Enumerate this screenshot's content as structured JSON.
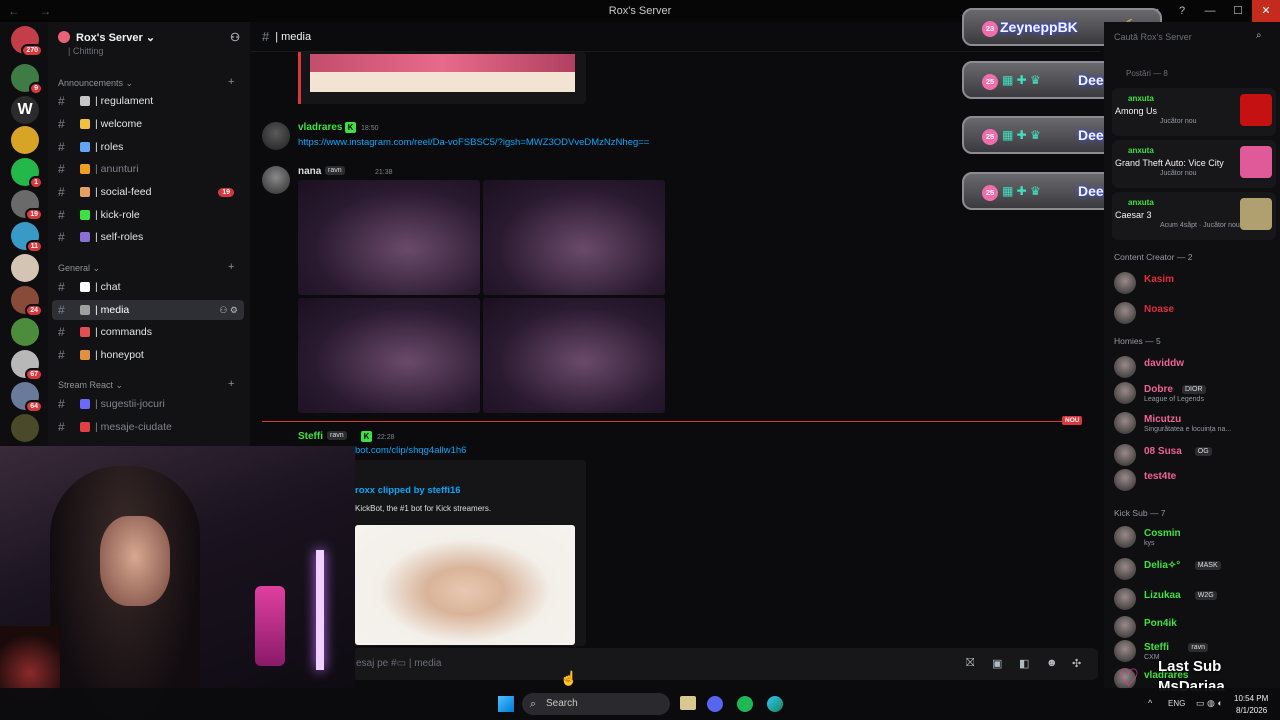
{
  "window": {
    "title": "Rox's Server",
    "nav_arrows": "← →",
    "controls": [
      "▭",
      "?",
      "—",
      "☐",
      "✕"
    ]
  },
  "servers": [
    {
      "badge": "270",
      "color": "#c33d4b"
    },
    {
      "badge": "9",
      "color": "#3f7b45"
    },
    {
      "badge": "",
      "color": "#2b2b2b",
      "glyph": "W"
    },
    {
      "badge": "",
      "color": "#d7a425"
    },
    {
      "badge": "1",
      "color": "#24b84a"
    },
    {
      "badge": "19",
      "color": "#6a6a6a"
    },
    {
      "badge": "11",
      "color": "#3a9ac7"
    },
    {
      "badge": "",
      "color": "#d4c4b4"
    },
    {
      "badge": "24",
      "color": "#8a4a3a"
    },
    {
      "badge": "",
      "color": "#4c8c3c"
    },
    {
      "badge": "67",
      "color": "#b8b8b8"
    },
    {
      "badge": "64",
      "color": "#6a7a9a"
    },
    {
      "badge": "",
      "color": "#4a4a2a"
    }
  ],
  "sidebar": {
    "server_name": "Rox's Server ⌄",
    "top_clipped": "| Chitting",
    "categories": [
      {
        "label": "Announcements ⌄"
      },
      {
        "label": "General ⌄"
      },
      {
        "label": "Stream React ⌄"
      }
    ],
    "channels": [
      {
        "name": "| regulament",
        "emo": "#c6c6c6"
      },
      {
        "name": "| welcome",
        "emo": "#f0c040"
      },
      {
        "name": "| roles",
        "emo": "#63a4f7"
      },
      {
        "name": "| anunturi",
        "emo": "#f0a020",
        "muted": true
      },
      {
        "name": "| social-feed",
        "emo": "#e8a060",
        "count": "19"
      },
      {
        "name": "| kick-role",
        "emo": "#3ee240"
      },
      {
        "name": "| self-roles",
        "emo": "#8b6fd6"
      },
      {
        "name": "| chat",
        "emo": "#ffffff"
      },
      {
        "name": "| media",
        "emo": "#a0a0a0",
        "active": true
      },
      {
        "name": "| commands",
        "emo": "#e05050"
      },
      {
        "name": "| honeypot",
        "emo": "#e09040"
      },
      {
        "name": "| sugestii-jocuri",
        "emo": "#6a6aff",
        "muted": true
      },
      {
        "name": "| mesaje-ciudate",
        "emo": "#e04040",
        "muted": true
      }
    ]
  },
  "chat": {
    "channel": "| media",
    "messages": [
      {
        "author": "vladrares",
        "time": "18:50",
        "color": "#3ee240",
        "text": "https://www.instagram.com/reel/Da-voFSBSC5/?igsh=MWZ3ODVveDMzNzNheg=="
      },
      {
        "author": "nana",
        "role": "ravn",
        "time": "21:38",
        "color": "#dbdee1"
      },
      {
        "author": "Steffi",
        "role": "ravn",
        "time": "22:28",
        "color": "#3ee240",
        "text": "bot.com/clip/shqg4allw1h6",
        "embed_title": "roxx clipped by steffi16",
        "embed_desc": "KickBot, the #1 bot for Kick streamers."
      }
    ],
    "new_label": "NOU",
    "composer_placeholder": "esaj pe #▭ | media"
  },
  "overlay_users": [
    {
      "level": "23",
      "name": "ZeyneppBK"
    },
    {
      "level": "25",
      "name": "DeeaW"
    },
    {
      "level": "25",
      "name": "DeeaW"
    },
    {
      "level": "25",
      "name": "DeeaW"
    }
  ],
  "members": {
    "search_placeholder": "Caută Rox's Server",
    "header": "Postări — 8",
    "games": [
      {
        "user": "anxuta",
        "game": "Among Us",
        "sub": "Jucător nou",
        "color": "#c51111"
      },
      {
        "user": "anxuta",
        "game": "Grand Theft Auto: Vice City",
        "sub": "Jucător nou",
        "color": "#e05a9a"
      },
      {
        "user": "anxuta",
        "game": "Caesar 3",
        "sub": "Acum 4săpt · Jucător nou",
        "color": "#b0a070"
      }
    ],
    "groups": [
      {
        "title": "Content Creator — 2",
        "members": [
          {
            "name": "Kasim",
            "color": "#e0303a"
          },
          {
            "name": "Noase",
            "color": "#e0303a"
          }
        ]
      },
      {
        "title": "Homies — 5",
        "members": [
          {
            "name": "daviddw",
            "color": "#f06292"
          },
          {
            "name": "Dobre",
            "color": "#f06292",
            "tag": "DIOR",
            "sub": "League of Legends"
          },
          {
            "name": "Micutzu",
            "color": "#f06292",
            "sub": "Singurătatea e locuința na..."
          },
          {
            "name": "08 Susa",
            "color": "#f06292",
            "tag": "OG"
          },
          {
            "name": "test4te",
            "color": "#f06292"
          }
        ]
      },
      {
        "title": "Kick Sub — 7",
        "members": [
          {
            "name": "Cosmin",
            "color": "#3ee240",
            "sub": "kys"
          },
          {
            "name": "Delia✧°",
            "color": "#3ee240",
            "tag": "MASK"
          },
          {
            "name": "Lizukaa",
            "color": "#3ee240",
            "tag": "W2G"
          },
          {
            "name": "Pon4ik",
            "color": "#3ee240"
          },
          {
            "name": "Steffi",
            "color": "#3ee240",
            "tag": "ravn",
            "sub": "CXM"
          },
          {
            "name": "vladrares",
            "color": "#3ee240"
          }
        ]
      }
    ]
  },
  "last_sub": {
    "label": "Last Sub",
    "name": "MsDariaa"
  },
  "taskbar": {
    "search": "Search",
    "lang": "ENG",
    "time": "10:54 PM",
    "date": "8/1/2026"
  }
}
